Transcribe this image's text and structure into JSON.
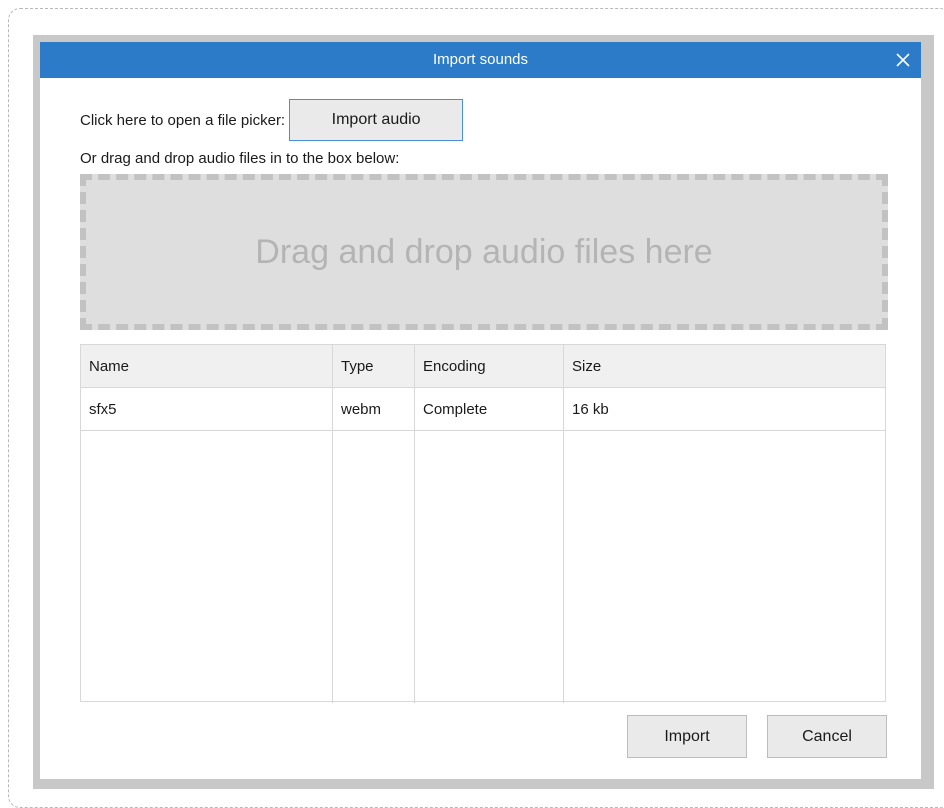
{
  "dialog": {
    "title": "Import sounds",
    "picker_label": "Click here to open a file picker:",
    "import_audio_label": "Import audio",
    "drag_label": "Or drag and drop audio files in to the box below:",
    "dropzone_text": "Drag and drop audio files here"
  },
  "table": {
    "headers": [
      "Name",
      "Type",
      "Encoding",
      "Size"
    ],
    "rows": [
      {
        "name": "sfx5",
        "type": "webm",
        "encoding": "Complete",
        "size": "16 kb"
      }
    ]
  },
  "footer": {
    "import_label": "Import",
    "cancel_label": "Cancel"
  },
  "icons": {
    "close": "close-icon"
  },
  "colors": {
    "titlebar": "#2b7bc8",
    "dropzone": "#dedede",
    "button_focus_border": "#4a8fd6"
  }
}
